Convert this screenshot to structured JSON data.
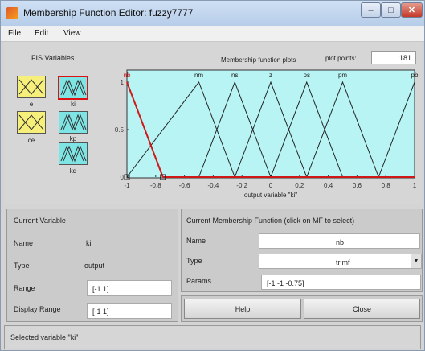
{
  "window": {
    "title": "Membership Function Editor: fuzzy7777"
  },
  "menu": [
    "File",
    "Edit",
    "View"
  ],
  "fis": {
    "title": "FIS Variables",
    "inputs": [
      {
        "label": "e"
      },
      {
        "label": "ce"
      }
    ],
    "outputs": [
      {
        "label": "ki"
      },
      {
        "label": "kp"
      },
      {
        "label": "kd"
      }
    ]
  },
  "plot": {
    "title": "Membership function plots",
    "points_label": "plot points:",
    "points_value": "181",
    "xlabel": "output variable \"ki\""
  },
  "chart_data": {
    "type": "line",
    "title": "Membership function plots",
    "xlabel": "output variable \"ki\"",
    "xlim": [
      -1,
      1
    ],
    "ylim": [
      0,
      1
    ],
    "xticks": [
      "-1",
      "-0.8",
      "-0.6",
      "-0.4",
      "-0.2",
      "0",
      "0.2",
      "0.4",
      "0.6",
      "0.8",
      "1"
    ],
    "yticks": [
      "0",
      "0.5",
      "1"
    ],
    "background": "#b8f4f4",
    "series": [
      {
        "name": "nb",
        "points": [
          [
            -1,
            1
          ],
          [
            -1,
            1
          ],
          [
            -0.75,
            0
          ]
        ],
        "color": "#d01818",
        "selected": true
      },
      {
        "name": "nm",
        "points": [
          [
            -1,
            0
          ],
          [
            -0.5,
            1
          ],
          [
            -0.25,
            0
          ]
        ],
        "color": "#222222"
      },
      {
        "name": "ns",
        "points": [
          [
            -0.5,
            0
          ],
          [
            -0.25,
            1
          ],
          [
            0,
            0
          ]
        ],
        "color": "#222222"
      },
      {
        "name": "z",
        "points": [
          [
            -0.25,
            0
          ],
          [
            0,
            1
          ],
          [
            0.25,
            0
          ]
        ],
        "color": "#222222"
      },
      {
        "name": "ps",
        "points": [
          [
            0,
            0
          ],
          [
            0.25,
            1
          ],
          [
            0.5,
            0
          ]
        ],
        "color": "#222222"
      },
      {
        "name": "pm",
        "points": [
          [
            0.25,
            0
          ],
          [
            0.5,
            1
          ],
          [
            0.75,
            0
          ]
        ],
        "color": "#222222"
      },
      {
        "name": "pb",
        "points": [
          [
            0.75,
            0
          ],
          [
            1,
            1
          ],
          [
            1,
            1
          ]
        ],
        "color": "#222222"
      }
    ]
  },
  "current_variable": {
    "title": "Current Variable",
    "name_label": "Name",
    "name_value": "ki",
    "type_label": "Type",
    "type_value": "output",
    "range_label": "Range",
    "range_value": "[-1 1]",
    "display_range_label": "Display Range",
    "display_range_value": "[-1 1]"
  },
  "current_mf": {
    "title": "Current Membership Function (click on MF to select)",
    "name_label": "Name",
    "name_value": "nb",
    "type_label": "Type",
    "type_value": "trimf",
    "params_label": "Params",
    "params_value": "[-1 -1 -0.75]"
  },
  "buttons": {
    "help": "Help",
    "close": "Close"
  },
  "status": "Selected variable \"ki\""
}
